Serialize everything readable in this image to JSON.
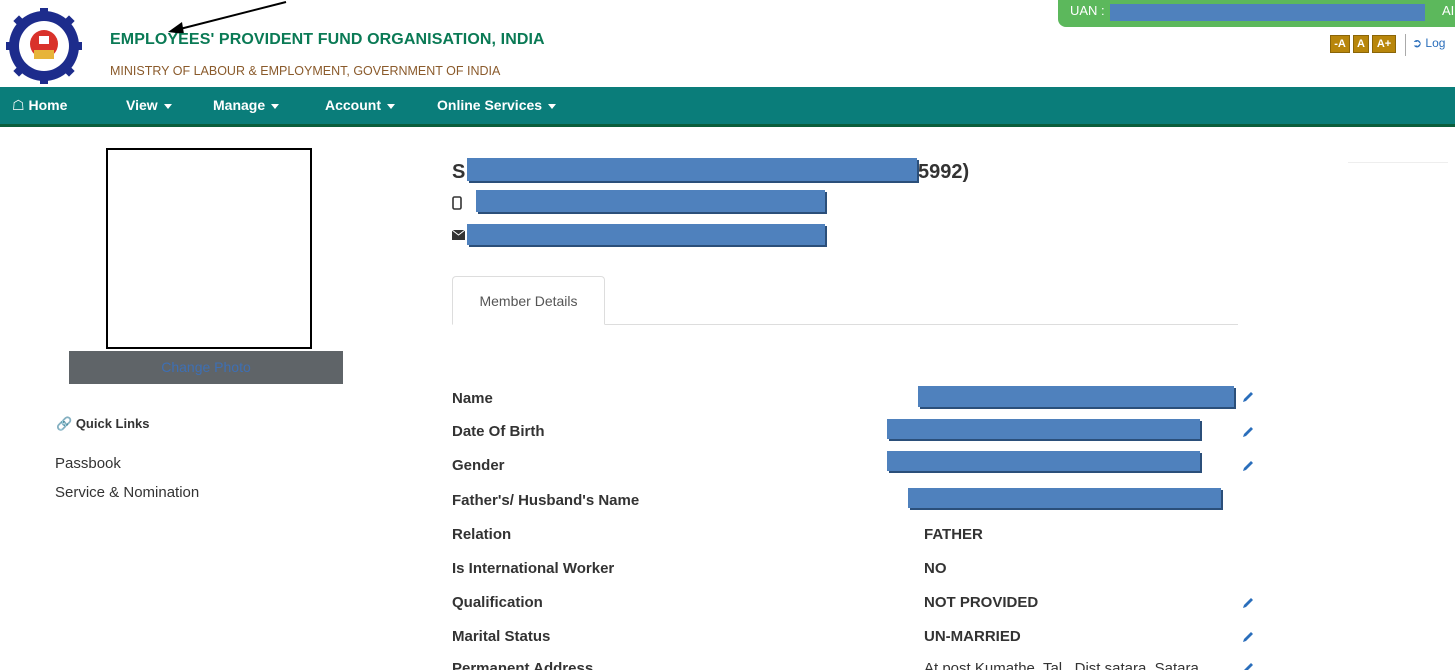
{
  "header": {
    "org_title": "EMPLOYEES' PROVIDENT FUND ORGANISATION, INDIA",
    "org_subtitle": "MINISTRY OF LABOUR & EMPLOYMENT, GOVERNMENT OF INDIA",
    "uan_label": "UAN :",
    "uan_suffix": "AI",
    "font_small": "-A",
    "font_normal": "A",
    "font_large": "A+",
    "logout_label": "Log"
  },
  "nav": {
    "home": "Home",
    "view": "View",
    "manage": "Manage",
    "account": "Account",
    "online_services": "Online Services"
  },
  "sidebar": {
    "change_photo": "Change Photo",
    "quick_links_title": "Quick Links",
    "links": [
      "Passbook",
      "Service & Nomination"
    ]
  },
  "profile": {
    "name_initial": "S",
    "name_suffix": "5992)",
    "tab": "Member Details"
  },
  "details": [
    {
      "label": "Name",
      "value": "",
      "editable": true
    },
    {
      "label": "Date Of Birth",
      "value": "",
      "editable": true
    },
    {
      "label": "Gender",
      "value": "",
      "editable": true
    },
    {
      "label": "Father's/ Husband's Name",
      "value": "",
      "editable": false
    },
    {
      "label": "Relation",
      "value": "FATHER",
      "editable": false
    },
    {
      "label": "Is International Worker",
      "value": "NO",
      "editable": false
    },
    {
      "label": "Qualification",
      "value": "NOT PROVIDED",
      "editable": true
    },
    {
      "label": "Marital Status",
      "value": "UN-MARRIED",
      "editable": true
    },
    {
      "label": "Permanent Address",
      "value": "At post Kumathe, Tal., Dist satara, Satara",
      "editable": true
    }
  ],
  "colors": {
    "navbar": "#0a7d7a",
    "uan_badge": "#5cb85c",
    "redaction": "#4f81bd",
    "org_title": "#0a7a55"
  }
}
